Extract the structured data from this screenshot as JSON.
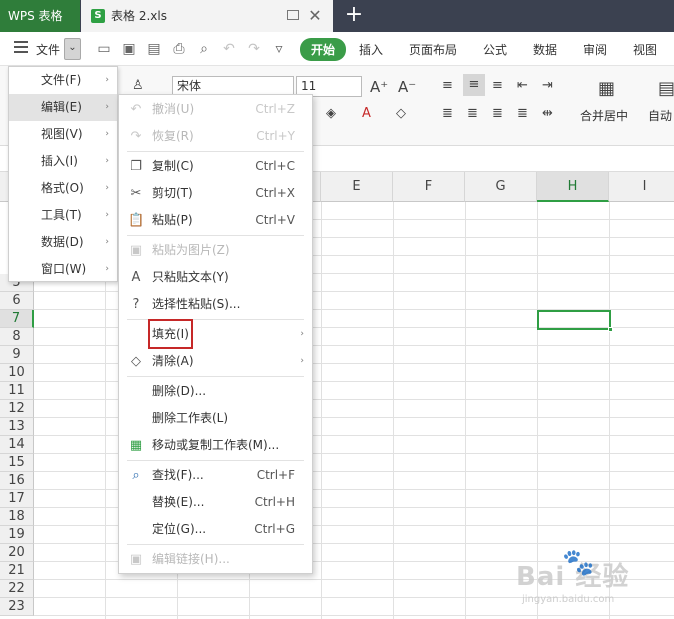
{
  "titlebar": {
    "app_name": "WPS 表格",
    "doc_title": "表格 2.xls",
    "doc_icon": "S",
    "close_glyph": "✕",
    "new_tab_glyph": "+"
  },
  "menu_bar": {
    "file_label": "文件",
    "dropdown_glyph": "⌄",
    "ribbon_tabs": [
      "开始",
      "插入",
      "页面布局",
      "公式",
      "数据",
      "审阅",
      "视图"
    ],
    "active_tab": "开始"
  },
  "ribbon": {
    "font_name": "宋体",
    "font_size": "11",
    "merge_label": "合并居中",
    "wrap_label": "自动"
  },
  "main_menu": {
    "items": [
      {
        "label": "文件(F)"
      },
      {
        "label": "编辑(E)"
      },
      {
        "label": "视图(V)"
      },
      {
        "label": "插入(I)"
      },
      {
        "label": "格式(O)"
      },
      {
        "label": "工具(T)"
      },
      {
        "label": "数据(D)"
      },
      {
        "label": "窗口(W)"
      }
    ],
    "active_item": "编辑(E)",
    "arrow_glyph": "›"
  },
  "edit_submenu": {
    "items": [
      {
        "label": "撤消(U)",
        "shortcut": "Ctrl+Z",
        "icon": "undo-icon",
        "glyph": "↶",
        "enabled": false
      },
      {
        "label": "恢复(R)",
        "shortcut": "Ctrl+Y",
        "icon": "redo-icon",
        "glyph": "↷",
        "enabled": false
      },
      {
        "label": "复制(C)",
        "shortcut": "Ctrl+C",
        "icon": "copy-icon",
        "glyph": "❐",
        "enabled": true
      },
      {
        "label": "剪切(T)",
        "shortcut": "Ctrl+X",
        "icon": "scissors-icon",
        "glyph": "✂",
        "enabled": true
      },
      {
        "label": "粘贴(P)",
        "shortcut": "Ctrl+V",
        "icon": "paste-icon",
        "glyph": "📋",
        "enabled": true
      },
      {
        "label": "粘贴为图片(Z)",
        "shortcut": "",
        "icon": "paste-picture-icon",
        "glyph": "▣",
        "enabled": false
      },
      {
        "label": "只粘贴文本(Y)",
        "shortcut": "",
        "icon": "paste-text-icon",
        "glyph": "A",
        "enabled": true
      },
      {
        "label": "选择性粘贴(S)...",
        "shortcut": "",
        "icon": "paste-special-icon",
        "glyph": "?",
        "enabled": true
      },
      {
        "label": "填充(I)",
        "shortcut": "",
        "icon": "",
        "glyph": "",
        "enabled": true,
        "submenu": true,
        "highlighted": true
      },
      {
        "label": "清除(A)",
        "shortcut": "",
        "icon": "eraser-icon",
        "glyph": "◇",
        "enabled": true,
        "submenu": true
      },
      {
        "label": "删除(D)...",
        "shortcut": "",
        "icon": "",
        "glyph": "",
        "enabled": true
      },
      {
        "label": "删除工作表(L)",
        "shortcut": "",
        "icon": "",
        "glyph": "",
        "enabled": true
      },
      {
        "label": "移动或复制工作表(M)...",
        "shortcut": "",
        "icon": "move-sheet-icon",
        "glyph": "▦",
        "enabled": true
      },
      {
        "label": "查找(F)...",
        "shortcut": "Ctrl+F",
        "icon": "search-icon",
        "glyph": "⌕",
        "enabled": true
      },
      {
        "label": "替换(E)...",
        "shortcut": "Ctrl+H",
        "icon": "",
        "glyph": "",
        "enabled": true
      },
      {
        "label": "定位(G)...",
        "shortcut": "Ctrl+G",
        "icon": "",
        "glyph": "",
        "enabled": true
      },
      {
        "label": "编辑链接(H)...",
        "shortcut": "",
        "icon": "edit-link-icon",
        "glyph": "▣",
        "enabled": false
      }
    ]
  },
  "sheet": {
    "columns": [
      "E",
      "F",
      "G",
      "H",
      "I"
    ],
    "selected_column": "H",
    "rows": [
      "5",
      "6",
      "7",
      "8",
      "9",
      "10",
      "11",
      "12",
      "13",
      "14",
      "15",
      "16",
      "17",
      "18",
      "19",
      "20",
      "21",
      "22",
      "23"
    ],
    "selected_row": "7"
  },
  "watermark": {
    "brand": "Bai  经验",
    "paw": "🐾",
    "url": "jingyan.baidu.com"
  },
  "colors": {
    "titlebar_bg": "#3b4150",
    "app_tab_bg": "#2f7d3a",
    "active_tab_bg": "#3a9c48",
    "selection_green": "#2f9e44",
    "highlight_box": "#c62828"
  }
}
